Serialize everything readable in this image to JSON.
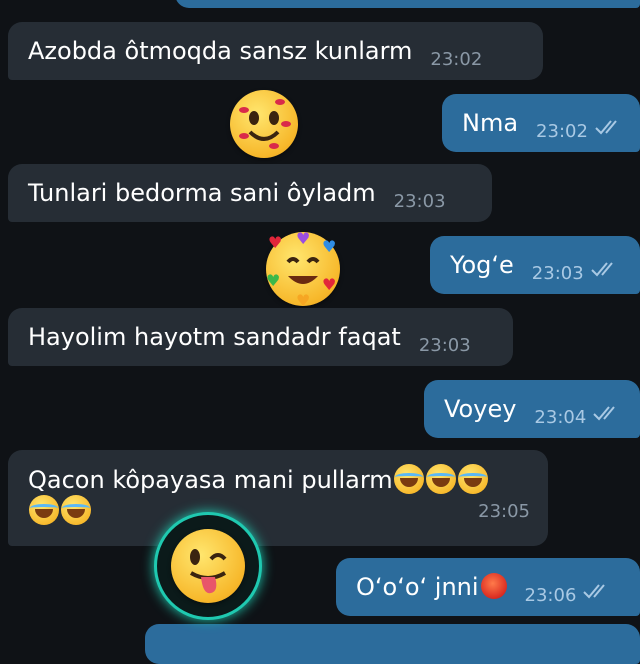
{
  "messages": [
    {
      "id": "m1",
      "dir": "in",
      "text": "Azobda  ôtmoqda sansz kunlarm",
      "time": "23:02"
    },
    {
      "id": "m2",
      "dir": "out",
      "text": "Nma",
      "time": "23:02"
    },
    {
      "id": "m3",
      "dir": "in",
      "text": "Tunlari bedorma sani ôyladm",
      "time": "23:03"
    },
    {
      "id": "m4",
      "dir": "out",
      "text": "Yog‘e",
      "time": "23:03"
    },
    {
      "id": "m5",
      "dir": "in",
      "text": "Hayolim hayotm sandadr faqat",
      "time": "23:03"
    },
    {
      "id": "m6",
      "dir": "out",
      "text": "Voyey",
      "time": "23:04"
    },
    {
      "id": "m7",
      "dir": "in",
      "text": "Qacon kôpayasa mani pullarm",
      "time": "23:05",
      "emoji_count": 5
    },
    {
      "id": "m8",
      "dir": "out",
      "text": "O‘o‘o‘ jnni",
      "time": "23:06"
    }
  ],
  "stickers": [
    {
      "name": "kissing-face-sticker",
      "icon": "face-with-lipstick-kisses"
    },
    {
      "name": "smiling-face-hearts-sticker",
      "icon": "smiling-face-with-hearts"
    },
    {
      "name": "winking-tongue-sticker",
      "icon": "winking-face-with-tongue"
    }
  ],
  "colors": {
    "background": "#0f1216",
    "incoming_bubble": "#262d35",
    "outgoing_bubble": "#2c6c9c"
  }
}
